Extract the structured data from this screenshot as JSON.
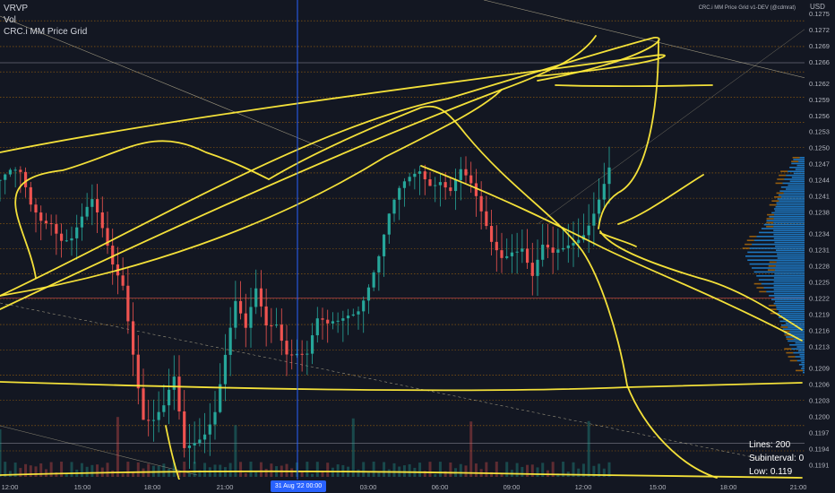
{
  "indicators": [
    "VRVP",
    "Vol",
    "CRC.i MM Price Grid"
  ],
  "watermark": "CRC.i MM Price Grid v1-DEV (@cdmrat)",
  "currency_label": "USD",
  "info_box": {
    "lines_text": "Lines: 200",
    "subinterval_text": "Subinterval: 0",
    "low_text": "Low: 0.119"
  },
  "crosshair": {
    "date_label": "31 Aug '22   00:00"
  },
  "colors": {
    "background": "#131722",
    "up_candle": "#26a69a",
    "down_candle": "#ef5350",
    "grid_line": "#ff9800",
    "drawing": "#ffeb3b",
    "crosshair": "#2962ff",
    "volume_profile": "#2196f3"
  },
  "chart_data": {
    "type": "candlestick",
    "ylim": [
      0.11891,
      0.12768
    ],
    "y_axis_ticks": [
      "0.1275",
      "0.1272",
      "0.1269",
      "0.1266",
      "0.1262",
      "0.1259",
      "0.1256",
      "0.1253",
      "0.1250",
      "0.1247",
      "0.1244",
      "0.1241",
      "0.1238",
      "0.1234",
      "0.1231",
      "0.1228",
      "0.1225",
      "0.1222",
      "0.1219",
      "0.1216",
      "0.1213",
      "0.1209",
      "0.1206",
      "0.1203",
      "0.1200",
      "0.1197",
      "0.1194",
      "0.1191"
    ],
    "x_axis_ticks": [
      "12:00",
      "15:00",
      "18:00",
      "21:00",
      "03:00",
      "06:00",
      "09:00",
      "12:00",
      "15:00",
      "18:00",
      "21:00"
    ],
    "price_grid_levels": [
      0.12736,
      0.12688,
      0.12641,
      0.12594,
      0.12547,
      0.125,
      0.12453,
      0.12406,
      0.12359,
      0.12312,
      0.12265,
      0.12218,
      0.12171,
      0.12124,
      0.12077,
      0.1203,
      0.11983,
      0.11936
    ],
    "horizontal_lines": [
      0.12658,
      0.1222,
      0.1195
    ],
    "close_path": [
      [
        0,
        0.1244
      ],
      [
        2,
        0.1244
      ],
      [
        4,
        0.1243
      ],
      [
        6,
        0.1238
      ],
      [
        8,
        0.1237
      ],
      [
        10,
        0.1238
      ],
      [
        12,
        0.1235
      ],
      [
        14,
        0.1234
      ],
      [
        16,
        0.1236
      ],
      [
        18,
        0.1238
      ],
      [
        20,
        0.1233
      ],
      [
        22,
        0.1228
      ],
      [
        24,
        0.1226
      ],
      [
        26,
        0.1214
      ],
      [
        28,
        0.1201
      ],
      [
        30,
        0.1199
      ],
      [
        32,
        0.12
      ],
      [
        34,
        0.1205
      ],
      [
        36,
        0.1193
      ],
      [
        38,
        0.1196
      ],
      [
        40,
        0.1199
      ],
      [
        42,
        0.1203
      ],
      [
        44,
        0.1212
      ],
      [
        46,
        0.122
      ],
      [
        48,
        0.1214
      ],
      [
        50,
        0.1222
      ],
      [
        52,
        0.1217
      ],
      [
        54,
        0.1219
      ],
      [
        56,
        0.1214
      ],
      [
        58,
        0.1213
      ],
      [
        60,
        0.1211
      ],
      [
        62,
        0.1216
      ],
      [
        64,
        0.1215
      ],
      [
        66,
        0.1217
      ],
      [
        68,
        0.122
      ],
      [
        70,
        0.1222
      ],
      [
        72,
        0.1226
      ],
      [
        74,
        0.123
      ],
      [
        76,
        0.1236
      ],
      [
        78,
        0.124
      ],
      [
        80,
        0.1243
      ],
      [
        82,
        0.1246
      ],
      [
        84,
        0.1245
      ],
      [
        86,
        0.1246
      ],
      [
        88,
        0.1243
      ],
      [
        90,
        0.1245
      ],
      [
        92,
        0.1241
      ],
      [
        94,
        0.1236
      ],
      [
        96,
        0.1232
      ],
      [
        98,
        0.1231
      ],
      [
        100,
        0.1233
      ],
      [
        102,
        0.1233
      ],
      [
        104,
        0.1226
      ],
      [
        106,
        0.123
      ],
      [
        108,
        0.1228
      ],
      [
        110,
        0.123
      ],
      [
        112,
        0.1233
      ],
      [
        114,
        0.1236
      ],
      [
        116,
        0.124
      ],
      [
        118,
        0.1244
      ]
    ],
    "horizontal_span": 120
  }
}
